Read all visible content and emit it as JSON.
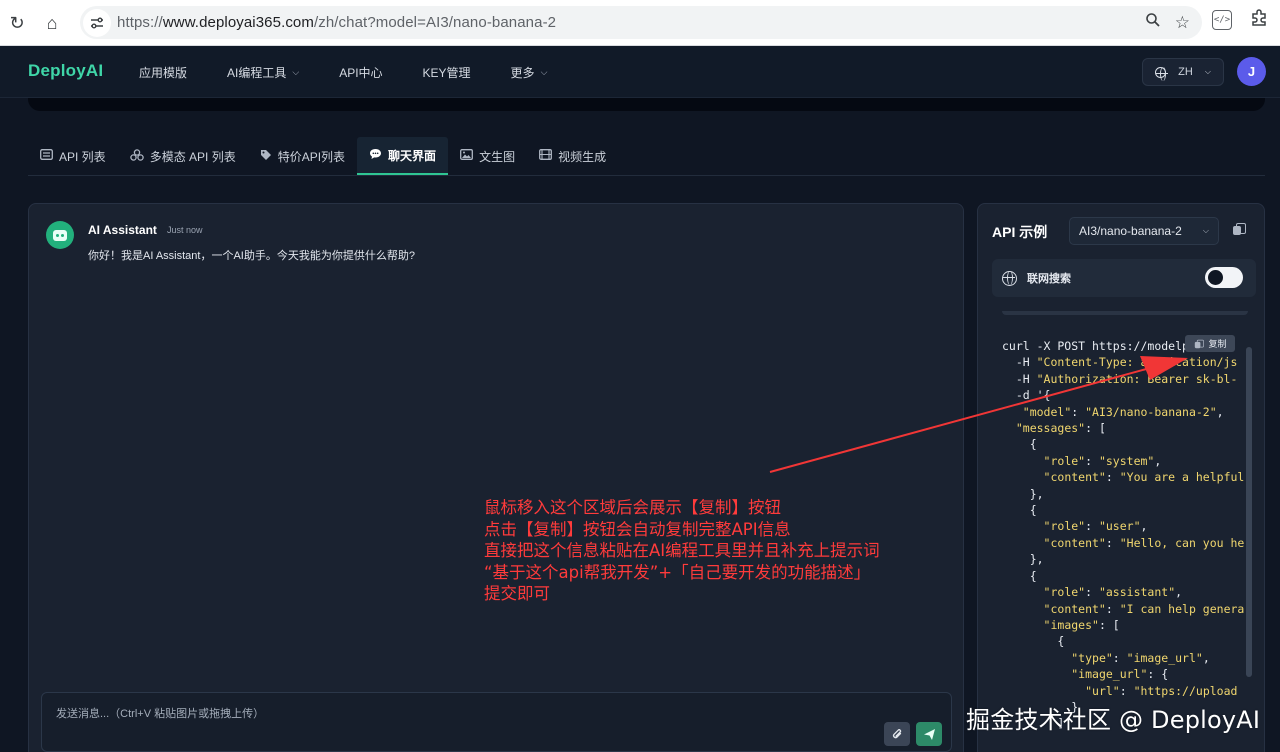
{
  "browser": {
    "url_prefix": "https://",
    "url_host": "www.deployai365.com",
    "url_path": "/zh/chat?model=AI3/nano-banana-2"
  },
  "header": {
    "logo": "DeployAI",
    "nav": [
      "应用模版",
      "AI编程工具",
      "API中心",
      "KEY管理",
      "更多"
    ],
    "lang": "ZH",
    "avatar_initial": "J"
  },
  "tabs": [
    {
      "label": "API 列表",
      "icon": "list-icon"
    },
    {
      "label": "多模态 API 列表",
      "icon": "multimodal-icon"
    },
    {
      "label": "特价API列表",
      "icon": "tag-icon"
    },
    {
      "label": "聊天界面",
      "icon": "chat-icon",
      "active": true
    },
    {
      "label": "文生图",
      "icon": "image-icon"
    },
    {
      "label": "视频生成",
      "icon": "video-icon"
    }
  ],
  "chat": {
    "assistant_name": "AI Assistant",
    "time": "Just now",
    "message": "你好！我是AI Assistant，一个AI助手。今天我能为你提供什么帮助?",
    "input_placeholder": "发送消息...（Ctrl+V 粘贴图片或拖拽上传）"
  },
  "api_panel": {
    "title": "API 示例",
    "model": "AI3/nano-banana-2",
    "search_label": "联网搜索",
    "search_enabled": false,
    "copy_label": "复制",
    "code_lines": [
      "curl -X POST https://modelp",
      "  -H \"Content-Type: application/js",
      "  -H \"Authorization: Bearer sk-bl-",
      "  -d '{",
      "   \"model\": \"AI3/nano-banana-2\",",
      "  \"messages\": [",
      "    {",
      "      \"role\": \"system\",",
      "      \"content\": \"You are a helpful",
      "    },",
      "    {",
      "      \"role\": \"user\",",
      "      \"content\": \"Hello, can you he",
      "    },",
      "    {",
      "      \"role\": \"assistant\",",
      "      \"content\": \"I can help genera",
      "      \"images\": [",
      "        {",
      "          \"type\": \"image_url\",",
      "          \"image_url\": {",
      "            \"url\": \"https://upload",
      "          }",
      "        ]"
    ]
  },
  "annotation": {
    "lines": [
      "鼠标移入这个区域后会展示【复制】按钮",
      "点击【复制】按钮会自动复制完整API信息",
      "直接把这个信息粘贴在AI编程工具里并且补充上提示词",
      "“基于这个api帮我开发”+「自己要开发的功能描述」",
      "提交即可"
    ],
    "color": "#ff3b3b"
  },
  "watermark": "掘金技术社区 @ DeployAI"
}
